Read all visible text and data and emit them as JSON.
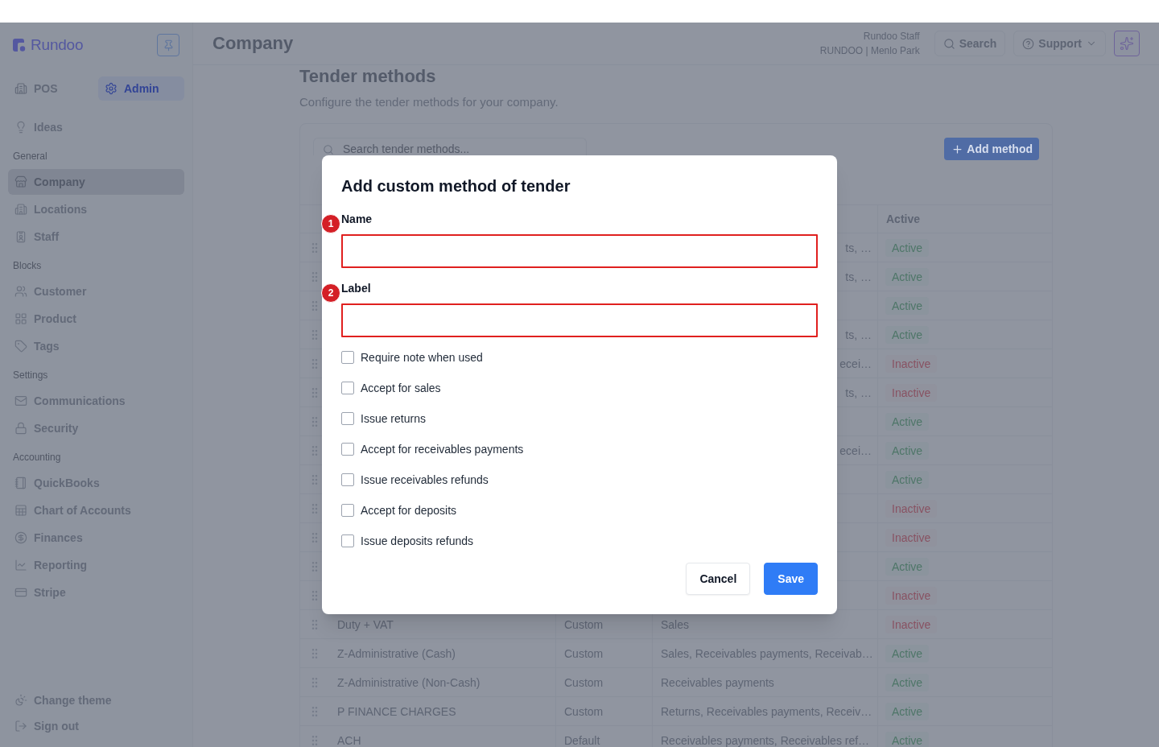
{
  "header": {
    "title": "Company",
    "user_name": "Rundoo Staff",
    "user_location": "RUNDOO | Menlo Park",
    "search_label": "Search",
    "support_label": "Support"
  },
  "sidebar": {
    "brand": "Rundoo",
    "modes": [
      {
        "label": "POS",
        "selected": false
      },
      {
        "label": "Admin",
        "selected": true
      }
    ],
    "groups": [
      {
        "items": [
          {
            "label": "Ideas",
            "selected": false
          }
        ]
      },
      {
        "heading": "General",
        "items": [
          {
            "label": "Company",
            "selected": true
          },
          {
            "label": "Locations",
            "selected": false
          },
          {
            "label": "Staff",
            "selected": false
          }
        ]
      },
      {
        "heading": "Blocks",
        "items": [
          {
            "label": "Customer",
            "selected": false
          },
          {
            "label": "Product",
            "selected": false
          },
          {
            "label": "Tags",
            "selected": false
          }
        ]
      },
      {
        "heading": "Settings",
        "items": [
          {
            "label": "Communications",
            "selected": false
          },
          {
            "label": "Security",
            "selected": false
          }
        ]
      },
      {
        "heading": "Accounting",
        "items": [
          {
            "label": "QuickBooks",
            "selected": false
          },
          {
            "label": "Chart of Accounts",
            "selected": false
          },
          {
            "label": "Finances",
            "selected": false
          },
          {
            "label": "Reporting",
            "selected": false
          },
          {
            "label": "Stripe",
            "selected": false
          }
        ]
      }
    ],
    "footer": [
      {
        "label": "Change theme"
      },
      {
        "label": "Sign out"
      }
    ]
  },
  "page": {
    "title": "Tender methods",
    "subtitle": "Configure the tender methods for your company.",
    "search": {
      "placeholder": "Search tender methods..."
    },
    "add_button": "Add method"
  },
  "table": {
    "status_heading": "Active",
    "rows": [
      {
        "methods_tail": "ts, …",
        "status": "Active",
        "active": true
      },
      {
        "methods_tail": "ts, …",
        "status": "Active",
        "active": true
      },
      {
        "status": "Active",
        "active": true
      },
      {
        "methods_tail": "ts, …",
        "status": "Active",
        "active": true
      },
      {
        "methods_tail": "ecei…",
        "status": "Inactive",
        "active": false
      },
      {
        "methods_tail": "ts, …",
        "status": "Inactive",
        "active": false
      },
      {
        "status": "Active",
        "active": true
      },
      {
        "methods_tail": "ecei…",
        "status": "Active",
        "active": true
      },
      {
        "status": "Active",
        "active": true
      },
      {
        "status": "Inactive",
        "active": false
      },
      {
        "status": "Inactive",
        "active": false
      },
      {
        "status": "Active",
        "active": true
      },
      {
        "status": "Inactive",
        "active": false
      },
      {
        "name": "Duty + VAT",
        "type": "Custom",
        "methods": "Sales",
        "status": "Inactive",
        "active": false
      },
      {
        "name": "Z-Administrative (Cash)",
        "type": "Custom",
        "methods": "Sales, Receivables payments, Receivab…",
        "status": "Active",
        "active": true
      },
      {
        "name": "Z-Administrative (Non-Cash)",
        "type": "Custom",
        "methods": "Receivables payments",
        "status": "Active",
        "active": true
      },
      {
        "name": "P FINANCE CHARGES",
        "type": "Custom",
        "methods": "Returns, Receivables payments, Receiv…",
        "status": "Active",
        "active": true
      },
      {
        "name": "ACH",
        "type": "Default",
        "methods": "Receivables payments, Receivables ref…",
        "status": "Active",
        "active": true
      }
    ]
  },
  "dialog": {
    "title": "Add custom method of tender",
    "fields": [
      {
        "label": "Name",
        "marker": "1",
        "highlighted": true
      },
      {
        "label": "Label",
        "marker": "2",
        "highlighted": true
      }
    ],
    "options": [
      {
        "label": "Require note when used",
        "checked": false
      },
      {
        "label": "Accept for sales",
        "checked": false
      },
      {
        "label": "Issue returns",
        "checked": false
      },
      {
        "label": "Accept for receivables payments",
        "checked": false
      },
      {
        "label": "Issue receivables refunds",
        "checked": false
      },
      {
        "label": "Accept for deposits",
        "checked": false
      },
      {
        "label": "Issue deposits refunds",
        "checked": false
      }
    ],
    "buttons": [
      {
        "label": "Cancel",
        "kind": "secondary"
      },
      {
        "label": "Save",
        "kind": "primary"
      }
    ]
  }
}
